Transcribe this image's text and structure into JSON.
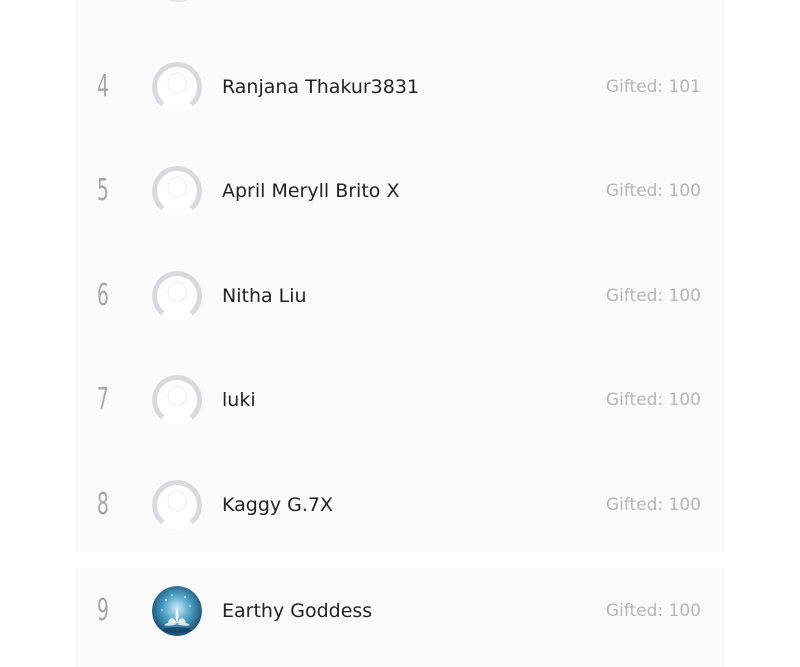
{
  "leaderboard": {
    "entries": [
      {
        "rank": "4",
        "name": "Ranjana Thakur3831",
        "gifted": "Gifted: 101",
        "avatar": "default-avatar"
      },
      {
        "rank": "5",
        "name": "April Meryll Brito X",
        "gifted": "Gifted: 100",
        "avatar": "default-avatar"
      },
      {
        "rank": "6",
        "name": "Nitha Liu",
        "gifted": "Gifted: 100",
        "avatar": "default-avatar"
      },
      {
        "rank": "7",
        "name": "luki",
        "gifted": "Gifted: 100",
        "avatar": "default-avatar"
      },
      {
        "rank": "8",
        "name": "Kaggy G.7X",
        "gifted": "Gifted: 100",
        "avatar": "default-avatar"
      },
      {
        "rank": "9",
        "name": "Earthy Goddess",
        "gifted": "Gifted: 100",
        "avatar": "lotus-photo-avatar"
      }
    ]
  },
  "colors": {
    "rank": "#a4a8ad",
    "name": "#1f2226",
    "gifted": "#b3b6ba",
    "row_background": "#fafafa",
    "default_avatar": "#d7dbe0"
  }
}
